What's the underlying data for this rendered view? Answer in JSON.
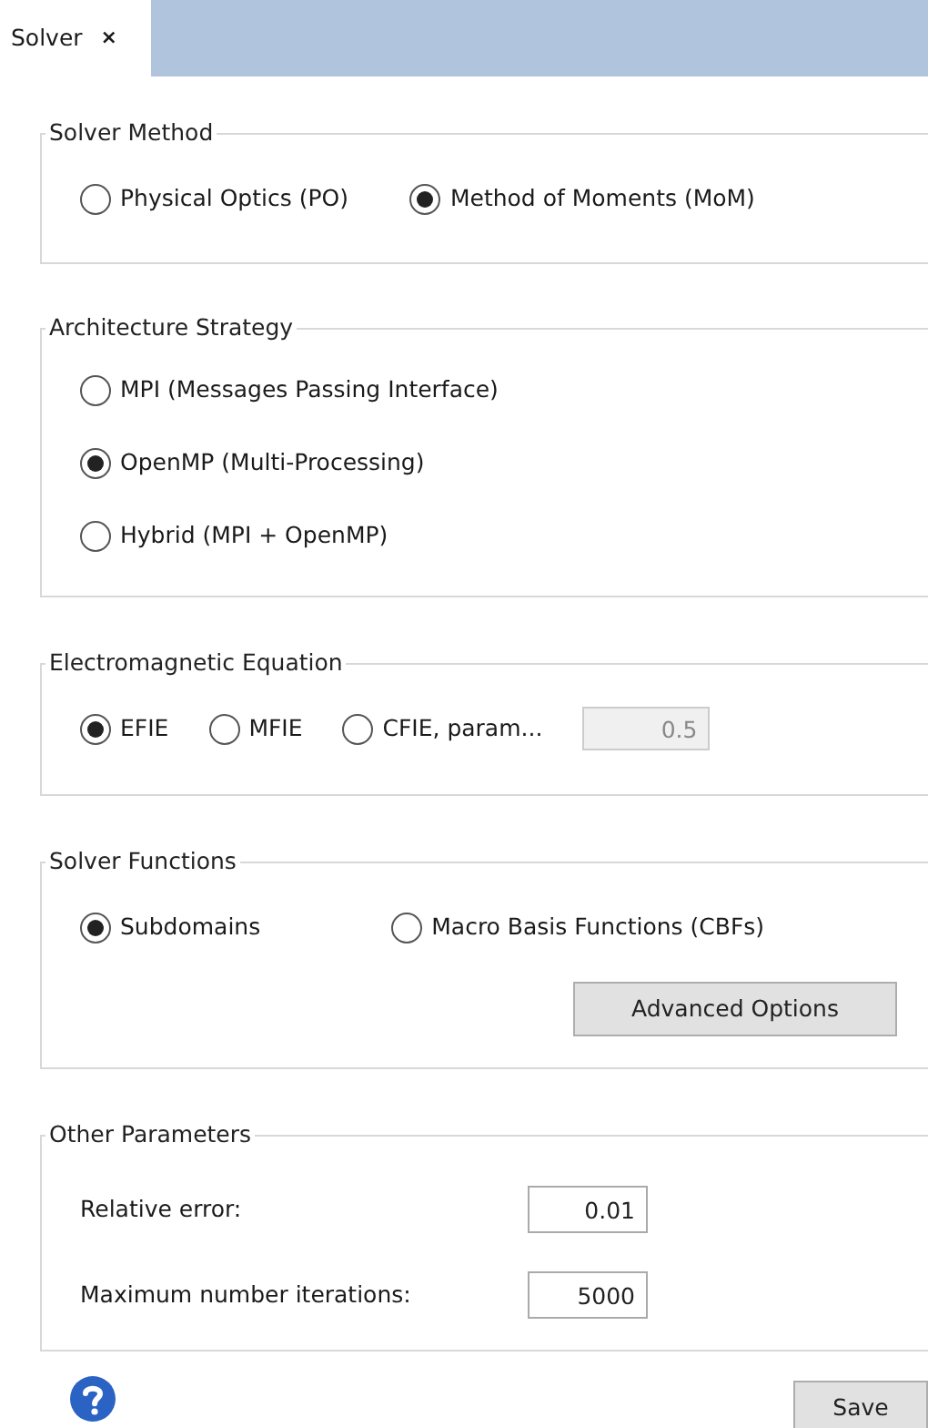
{
  "tab": {
    "label": "Solver",
    "close": "×",
    "selected": true
  },
  "groups": [
    {
      "title": "Solver Method",
      "kind": "radio_row",
      "options": [
        {
          "label": "Physical Optics (PO)",
          "selected": false
        },
        {
          "label": "Method of Moments (MoM)",
          "selected": true
        }
      ]
    },
    {
      "title": "Architecture Strategy",
      "kind": "radio_column",
      "options": [
        {
          "label": "MPI (Messages Passing Interface)",
          "selected": false
        },
        {
          "label": "OpenMP (Multi-Processing)",
          "selected": true
        },
        {
          "label": "Hybrid (MPI + OpenMP)",
          "selected": false
        }
      ]
    },
    {
      "title": "Electromagnetic Equation",
      "kind": "radio_row",
      "options": [
        {
          "label": "EFIE",
          "selected": true
        },
        {
          "label": "MFIE",
          "selected": false
        },
        {
          "label": "CFIE, param...",
          "selected": false
        }
      ],
      "field": {
        "value": "0.5",
        "disabled": true
      }
    },
    {
      "title": "Solver Functions",
      "kind": "radio_row",
      "options": [
        {
          "label": "Subdomains",
          "selected": true
        },
        {
          "label": "Macro Basis Functions (CBFs)",
          "selected": false
        }
      ],
      "button": "Advanced Options"
    },
    {
      "title": "Other Parameters",
      "kind": "fields",
      "fields": [
        {
          "label": "Relative error:",
          "value": "0.01"
        },
        {
          "label": "Maximum number iterations:",
          "value": "5000"
        }
      ]
    }
  ],
  "save_button": "Save"
}
